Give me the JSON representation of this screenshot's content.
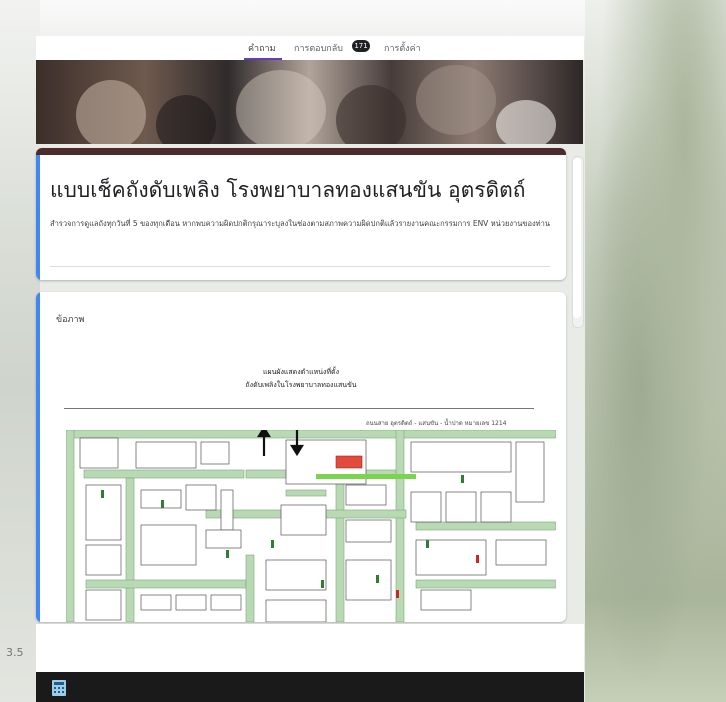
{
  "tabs": [
    {
      "label": "คำถาม",
      "active": true
    },
    {
      "label": "การตอบกลับ",
      "count": "171"
    },
    {
      "label": "การตั้งค่า"
    }
  ],
  "form": {
    "title": "แบบเช็คถังดับเพลิง โรงพยาบาลทองแสนขัน อุตรดิตถ์",
    "description": "สำรวจการดูแลถังทุกวันที่ 5 ของทุกเดือน หากพบความผิดปกติกรุณาระบุลงในช่องตามสภาพความผิดปกติแล้วรายงานคณะกรรมการ ENV หน่วยงานของท่าน"
  },
  "image_card": {
    "label": "ข้อภาพ",
    "map_title_line1": "แผนผังแสดงตำแหน่งที่ตั้ง",
    "map_title_line2": "ถังดับเพลิงในโรงพยาบาลทองแสนขัน",
    "map_caption": "ถนนสาย อุตรดิตถ์ - แสนขัน - น้ำปาด หมายเลข 1214"
  },
  "background_text": "3.5",
  "colors": {
    "accent": "#673ab7",
    "theme_bar": "#4b2b2b",
    "focus_bar": "#4285f4",
    "bottom_bar": "#1a1a1a"
  },
  "icons": [
    "calculator-icon",
    "arrow-up-icon",
    "arrow-down-icon"
  ]
}
